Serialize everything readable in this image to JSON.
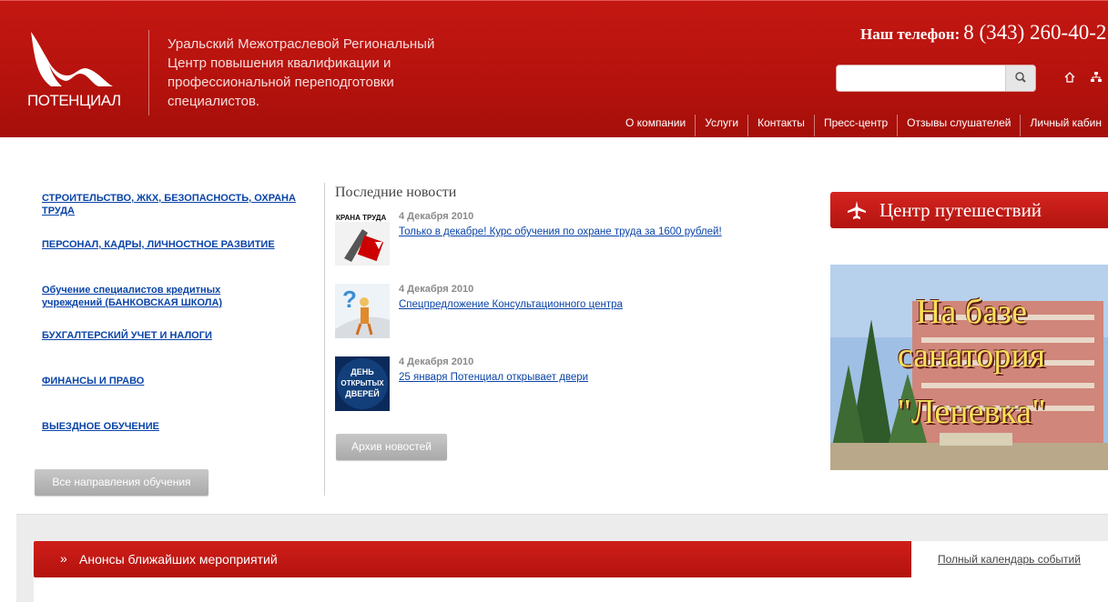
{
  "header": {
    "logo_text": "ПОТЕНЦИАЛ",
    "org_name": "Уральский Межотраслевой Региональный Центр повышения квалификации и профессиональной переподготовки специалистов.",
    "phone_label": "Наш телефон:",
    "phone_number": "8 (343) 260-40-2",
    "search_placeholder": "",
    "search_icon": "magnifier-icon",
    "home_icon": "home-icon",
    "sitemap_icon": "sitemap-icon",
    "nav": [
      "О компании",
      "Услуги",
      "Контакты",
      "Пресс-центр",
      "Отзывы слушателей",
      "Личный кабин"
    ]
  },
  "categories": {
    "items": [
      "СТРОИТЕЛЬСТВО, ЖКХ, БЕЗОПАСНОСТЬ, ОХРАНА ТРУДА",
      "ПЕРСОНАЛ, КАДРЫ, ЛИЧНОСТНОЕ РАЗВИТИЕ",
      "Обучение специалистов кредитных учреждений (БАНКОВСКАЯ ШКОЛА)",
      "БУХГАЛТЕРСКИЙ УЧЕТ И НАЛОГИ",
      "ФИНАНСЫ И ПРАВО",
      "ВЫЕЗДНОЕ ОБУЧЕНИЕ"
    ],
    "all_button": "Все направления обучения"
  },
  "news": {
    "title": "Последние новости",
    "items": [
      {
        "date": "4 Декабря 2010",
        "link": "Только в декабре! Курс обучения по охране труда за 1600 рублей!",
        "thumb_text": "КРАНА ТРУДА"
      },
      {
        "date": "4 Декабря 2010",
        "link": "Спецпредложение Консультационного центра",
        "thumb_text": ""
      },
      {
        "date": "4 Декабря 2010",
        "link": "25 января Потенциал открывает двери",
        "thumb_text": "ДЕНЬ ОТКРЫТЫХ ДВЕРЕЙ"
      }
    ],
    "archive_button": "Архив новостей"
  },
  "sidebar": {
    "travel_label": "Центр путешествий",
    "travel_icon": "airplane-icon",
    "banner_line1": "На базе",
    "banner_line2": "санатория",
    "banner_line3": "\"Леневка\""
  },
  "announcements": {
    "title": "Анонсы ближайших мероприятий",
    "arrow": "»",
    "calendar_link": "Полный календарь событий"
  }
}
